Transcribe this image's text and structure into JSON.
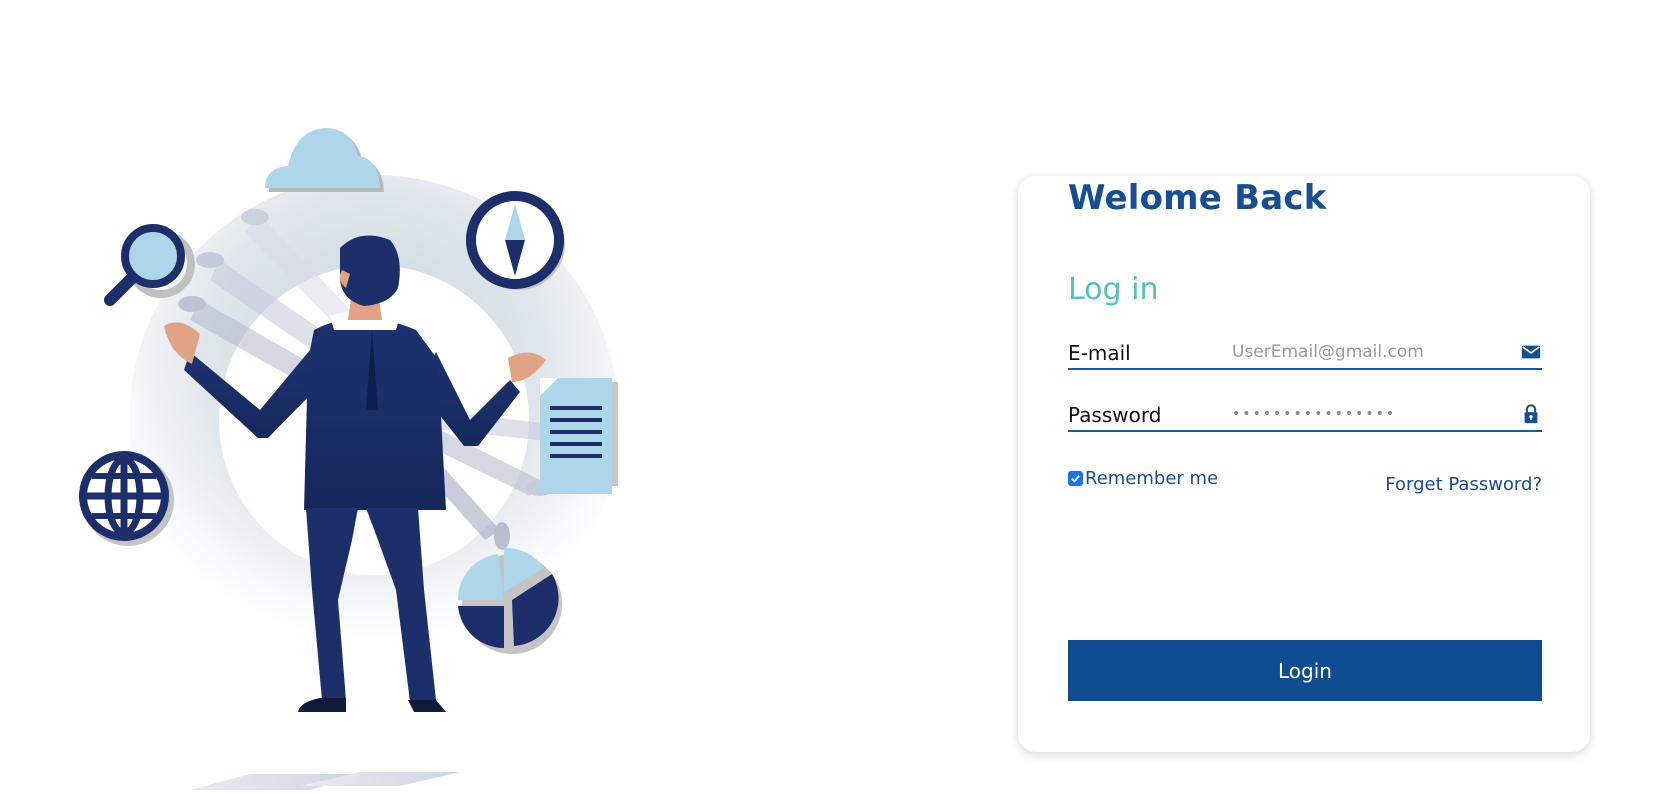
{
  "colors": {
    "brand": "#174d92",
    "accent": "#57bfc0",
    "button": "#0f4c92",
    "illustration_dark": "#1c2f6a",
    "illustration_light": "#aed6ea"
  },
  "card": {
    "welcome": "Welome Back",
    "title": "Log in",
    "email": {
      "label": "E-mail",
      "placeholder": "UserEmail@gmail.com",
      "icon": "envelope-icon"
    },
    "password": {
      "label": "Password",
      "value": "••••••••••••••••",
      "icon": "lock-icon"
    },
    "remember": {
      "label": "Remember me",
      "checked": true
    },
    "forgot_label": "Forget Password?",
    "login_label": "Login"
  },
  "illustration": {
    "icons": [
      "cloud-icon",
      "magnifier-icon",
      "compass-icon",
      "document-icon",
      "globe-icon",
      "pie-chart-icon"
    ]
  }
}
